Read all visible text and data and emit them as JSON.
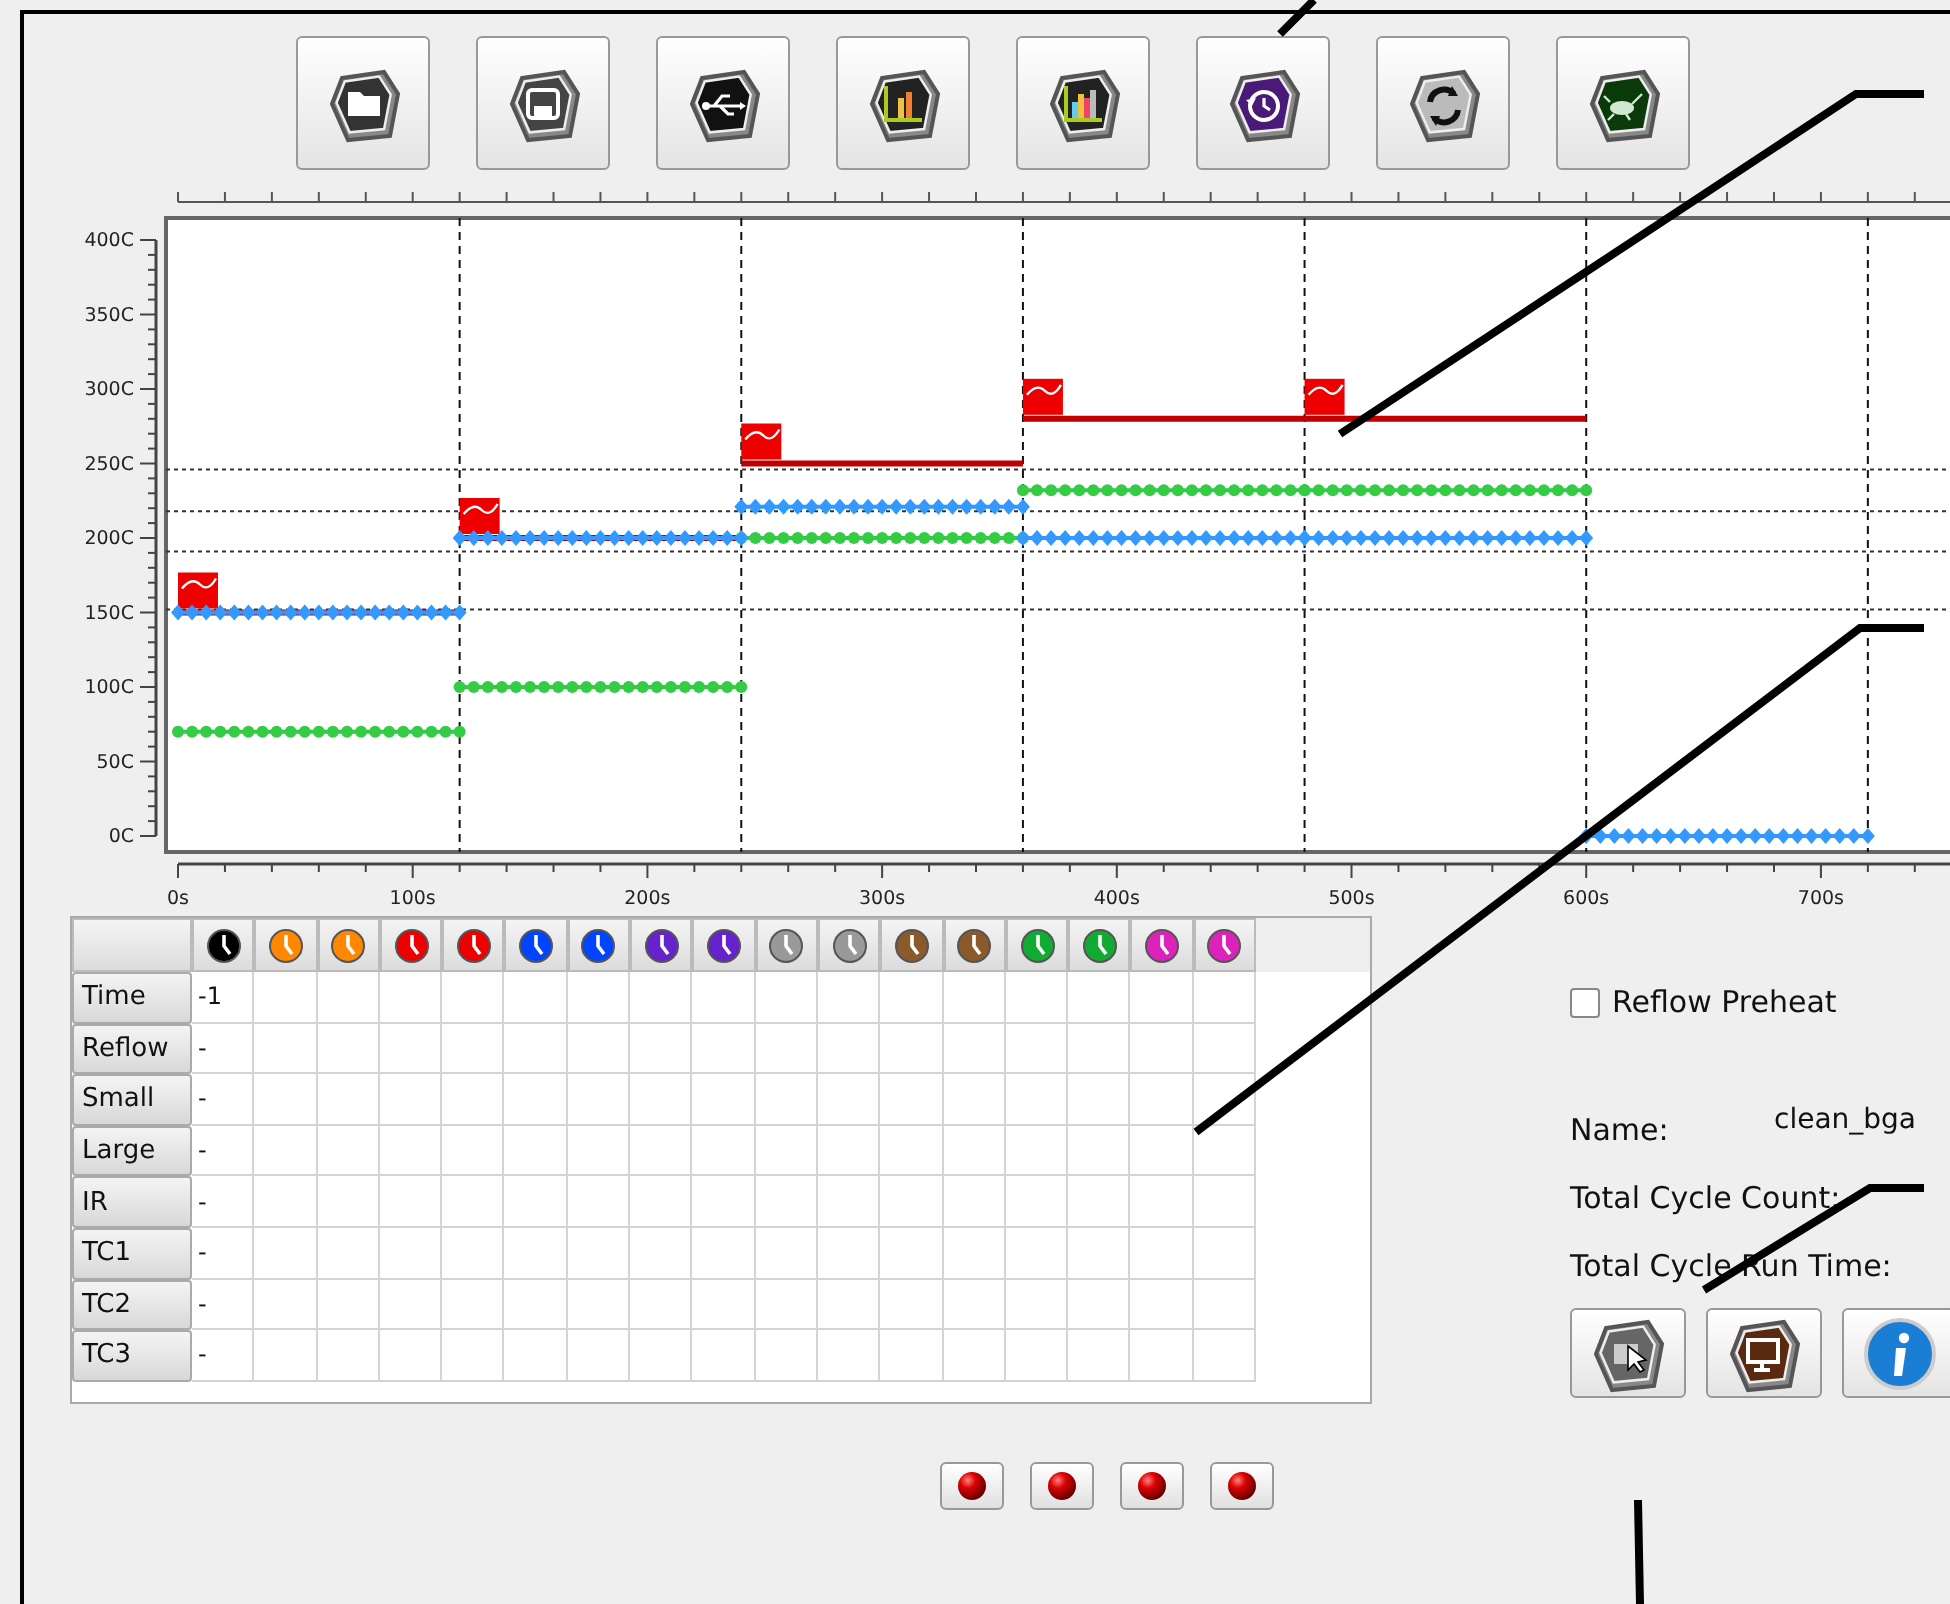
{
  "toolbar": [
    {
      "kind": "folder"
    },
    {
      "kind": "save"
    },
    {
      "kind": "usb"
    },
    {
      "kind": "chart"
    },
    {
      "kind": "multichart"
    },
    {
      "kind": "history"
    },
    {
      "kind": "refresh"
    },
    {
      "kind": "bug"
    }
  ],
  "chart_data": {
    "type": "line",
    "x": [
      0,
      6,
      12,
      18,
      24,
      30,
      36,
      42,
      48,
      54,
      60,
      66,
      72,
      78,
      84,
      90,
      96,
      102,
      108,
      114,
      120,
      120,
      126,
      132,
      138,
      144,
      150,
      156,
      162,
      168,
      174,
      180,
      186,
      192,
      198,
      204,
      210,
      216,
      222,
      228,
      234,
      240,
      240,
      246,
      252,
      258,
      264,
      270,
      276,
      282,
      288,
      294,
      300,
      306,
      312,
      318,
      324,
      330,
      336,
      342,
      348,
      354,
      360,
      360,
      366,
      372,
      378,
      384,
      390,
      396,
      402,
      408,
      414,
      420,
      426,
      432,
      438,
      444,
      450,
      456,
      462,
      468,
      474,
      480,
      480,
      486,
      492,
      498,
      504,
      510,
      516,
      522,
      528,
      534,
      540,
      546,
      552,
      558,
      564,
      570,
      576,
      582,
      588,
      594,
      600,
      600,
      606,
      612,
      618,
      624,
      630,
      636,
      642,
      648,
      654,
      660,
      666,
      672,
      678,
      684,
      690,
      696,
      702,
      708,
      714,
      720
    ],
    "xlim": [
      0,
      755
    ],
    "ylim": [
      0,
      400
    ],
    "xticks": [
      {
        "value": 0,
        "label": "0s"
      },
      {
        "value": 100,
        "label": "100s"
      },
      {
        "value": 200,
        "label": "200s"
      },
      {
        "value": 300,
        "label": "300s"
      },
      {
        "value": 400,
        "label": "400s"
      },
      {
        "value": 500,
        "label": "500s"
      },
      {
        "value": 600,
        "label": "600s"
      },
      {
        "value": 700,
        "label": "700s"
      }
    ],
    "yticks": [
      {
        "value": 0,
        "label": "0C"
      },
      {
        "value": 50,
        "label": "50C"
      },
      {
        "value": 100,
        "label": "100C"
      },
      {
        "value": 150,
        "label": "150C"
      },
      {
        "value": 200,
        "label": "200C"
      },
      {
        "value": 250,
        "label": "250C"
      },
      {
        "value": 300,
        "label": "300C"
      },
      {
        "value": 350,
        "label": "350C"
      },
      {
        "value": 400,
        "label": "400C"
      }
    ],
    "series": [
      {
        "color": "#c00000",
        "marker": "none",
        "values": [
          150,
          150,
          150,
          150,
          150,
          150,
          150,
          150,
          150,
          150,
          150,
          150,
          150,
          150,
          150,
          150,
          150,
          150,
          150,
          150,
          150,
          200,
          200,
          200,
          200,
          200,
          200,
          200,
          200,
          200,
          200,
          200,
          200,
          200,
          200,
          200,
          200,
          200,
          200,
          200,
          200,
          200,
          250,
          250,
          250,
          250,
          250,
          250,
          250,
          250,
          250,
          250,
          250,
          250,
          250,
          250,
          250,
          250,
          250,
          250,
          250,
          250,
          250,
          280,
          280,
          280,
          280,
          280,
          280,
          280,
          280,
          280,
          280,
          280,
          280,
          280,
          280,
          280,
          280,
          280,
          280,
          280,
          280,
          280,
          280,
          280,
          280,
          280,
          280,
          280,
          280,
          280,
          280,
          280,
          280,
          280,
          280,
          280,
          280,
          280,
          280,
          280,
          280,
          280,
          280,
          null,
          null,
          null,
          null,
          null,
          null,
          null,
          null,
          null,
          null,
          null,
          null,
          null,
          null,
          null,
          null,
          null,
          null,
          null,
          null,
          null
        ]
      },
      {
        "color": "#33cc44",
        "marker": "circle",
        "values": [
          70,
          70,
          70,
          70,
          70,
          70,
          70,
          70,
          70,
          70,
          70,
          70,
          70,
          70,
          70,
          70,
          70,
          70,
          70,
          70,
          70,
          100,
          100,
          100,
          100,
          100,
          100,
          100,
          100,
          100,
          100,
          100,
          100,
          100,
          100,
          100,
          100,
          100,
          100,
          100,
          100,
          100,
          200,
          200,
          200,
          200,
          200,
          200,
          200,
          200,
          200,
          200,
          200,
          200,
          200,
          200,
          200,
          200,
          200,
          200,
          200,
          200,
          200,
          232,
          232,
          232,
          232,
          232,
          232,
          232,
          232,
          232,
          232,
          232,
          232,
          232,
          232,
          232,
          232,
          232,
          232,
          232,
          232,
          232,
          232,
          232,
          232,
          232,
          232,
          232,
          232,
          232,
          232,
          232,
          232,
          232,
          232,
          232,
          232,
          232,
          232,
          232,
          232,
          232,
          232,
          null,
          null,
          null,
          null,
          null,
          null,
          null,
          null,
          null,
          null,
          null,
          null,
          null,
          null,
          null,
          null,
          null,
          null,
          null,
          null,
          null
        ]
      },
      {
        "color": "#3399ff",
        "marker": "diamond",
        "values": [
          150,
          150,
          150,
          150,
          150,
          150,
          150,
          150,
          150,
          150,
          150,
          150,
          150,
          150,
          150,
          150,
          150,
          150,
          150,
          150,
          150,
          200,
          200,
          200,
          200,
          200,
          200,
          200,
          200,
          200,
          200,
          200,
          200,
          200,
          200,
          200,
          200,
          200,
          200,
          200,
          200,
          200,
          221,
          221,
          221,
          221,
          221,
          221,
          221,
          221,
          221,
          221,
          221,
          221,
          221,
          221,
          221,
          221,
          221,
          221,
          221,
          221,
          221,
          200,
          200,
          200,
          200,
          200,
          200,
          200,
          200,
          200,
          200,
          200,
          200,
          200,
          200,
          200,
          200,
          200,
          200,
          200,
          200,
          200,
          200,
          200,
          200,
          200,
          200,
          200,
          200,
          200,
          200,
          200,
          200,
          200,
          200,
          200,
          200,
          200,
          200,
          200,
          200,
          200,
          200,
          0,
          0,
          0,
          0,
          0,
          0,
          0,
          0,
          0,
          0,
          0,
          0,
          0,
          0,
          0,
          0,
          0,
          0,
          0,
          0,
          0
        ]
      }
    ],
    "ref_lines": [
      {
        "axis": "y",
        "value": 246
      },
      {
        "axis": "y",
        "value": 218
      },
      {
        "axis": "y",
        "value": 191
      },
      {
        "axis": "y",
        "value": 152
      }
    ]
  },
  "table": {
    "columns": [
      {
        "color": "#000000"
      },
      {
        "color": "#ff8800"
      },
      {
        "color": "#ff8800"
      },
      {
        "color": "#ee0000"
      },
      {
        "color": "#ee0000"
      },
      {
        "color": "#0044ff"
      },
      {
        "color": "#0044ff"
      },
      {
        "color": "#6622cc"
      },
      {
        "color": "#6622cc"
      },
      {
        "color": "#999999"
      },
      {
        "color": "#999999"
      },
      {
        "color": "#8b5a2b"
      },
      {
        "color": "#8b5a2b"
      },
      {
        "color": "#11aa33"
      },
      {
        "color": "#11aa33"
      },
      {
        "color": "#dd22bb"
      },
      {
        "color": "#dd22bb"
      }
    ],
    "rows": [
      {
        "label": "Time",
        "cells": [
          "-1"
        ]
      },
      {
        "label": "Reflow",
        "cells": [
          "-"
        ]
      },
      {
        "label": "Small",
        "cells": [
          "-"
        ]
      },
      {
        "label": "Large",
        "cells": [
          "-"
        ]
      },
      {
        "label": "IR",
        "cells": [
          "-"
        ]
      },
      {
        "label": "TC1",
        "cells": [
          "-"
        ]
      },
      {
        "label": "TC2",
        "cells": [
          "-"
        ]
      },
      {
        "label": "TC3",
        "cells": [
          "-"
        ]
      }
    ]
  },
  "reflow_preheat": {
    "label": "Reflow Preheat",
    "checked": false
  },
  "info": [
    {
      "label": "Name:",
      "value": "clean_bga"
    },
    {
      "label": "Total Cycle Count:"
    },
    {
      "label": "Total Cycle Run Time:"
    }
  ],
  "actions": [
    {
      "kind": "cursor"
    },
    {
      "kind": "monitor"
    },
    {
      "kind": "info"
    }
  ],
  "indicators": [
    {
      "kind": "led"
    },
    {
      "kind": "led"
    },
    {
      "kind": "led"
    },
    {
      "kind": "led"
    }
  ]
}
